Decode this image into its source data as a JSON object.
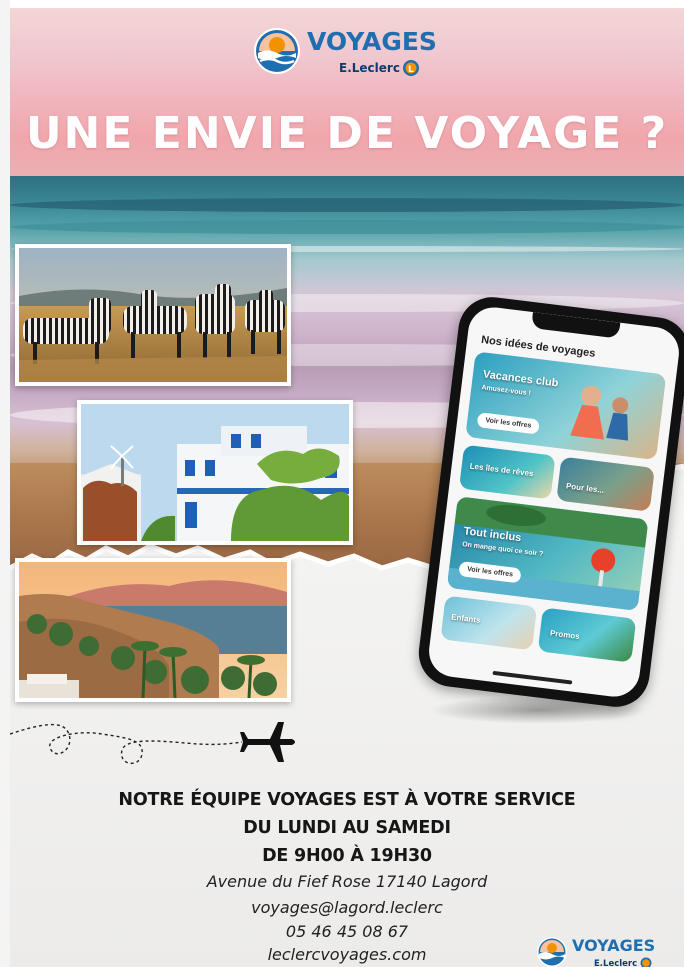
{
  "brand": {
    "name": "VOYAGES",
    "sub": "E.Leclerc",
    "colors": {
      "blue": "#1f6fb0",
      "orange": "#f29200",
      "navy": "#0e3b6b"
    }
  },
  "headline": "UNE ENVIE DE VOYAGE ?",
  "photos": [
    {
      "subject": "zebras-savanna"
    },
    {
      "subject": "white-house-terrace"
    },
    {
      "subject": "coastal-sunset-island"
    }
  ],
  "phone": {
    "title": "Nos idées de voyages",
    "cards": [
      {
        "label": "Vacances club",
        "sub": "Amusez-vous !",
        "button": "Voir les offres"
      },
      {
        "label": "Les îles de rêves"
      },
      {
        "label": "Pour les..."
      },
      {
        "label": "Tout inclus",
        "sub": "On mange quoi ce soir ?",
        "button": "Voir les offres"
      },
      {
        "label": "Enfants"
      },
      {
        "label": "Promos"
      }
    ]
  },
  "info": {
    "line1": "NOTRE ÉQUIPE VOYAGES EST À VOTRE SERVICE",
    "line2": "DU LUNDI AU SAMEDI",
    "line3": "DE 9H00 À 19H30",
    "address": "Avenue du Fief Rose 17140 Lagord",
    "email": "voyages@lagord.leclerc",
    "phone": "05 46 45 08 67",
    "website": "leclercvoyages.com"
  },
  "icons": [
    "airplane-icon",
    "voyages-logo-icon",
    "leclerc-badge-icon"
  ]
}
